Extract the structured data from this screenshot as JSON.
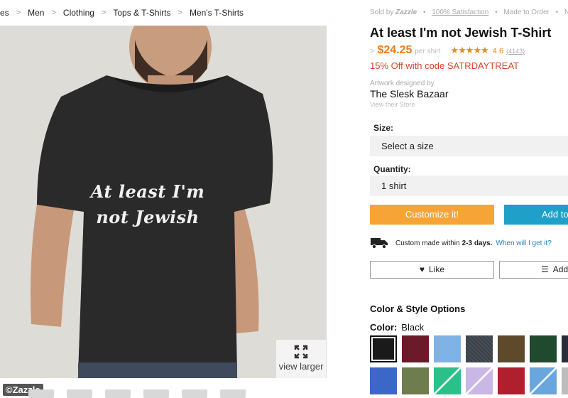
{
  "breadcrumb": {
    "items": [
      "es",
      "Men",
      "Clothing",
      "Tops & T-Shirts",
      "Men's T-Shirts"
    ],
    "separator": ">"
  },
  "image": {
    "shirt_text_line1": "At least I'm",
    "shirt_text_line2": "not Jewish",
    "view_larger": "view larger",
    "watermark": "©Zazzle"
  },
  "seller": {
    "sold_by": "Sold by",
    "brand": "Zazzle",
    "satisfaction": "100% Satisfaction",
    "made_to_order": "Made to Order",
    "trailing": "N"
  },
  "product": {
    "title": "At least I'm not Jewish T-Shirt",
    "price_arrow": ">",
    "price": "$24.25",
    "per_unit": "per shirt",
    "stars": "★★★★★",
    "rating": "4.6",
    "review_count": "(4143)",
    "promo": "15% Off with code SATRDAYTREAT",
    "artwork_label": "Artwork designed by",
    "store_name": "The Slesk Bazaar",
    "store_link": "View their Store"
  },
  "options": {
    "size_label": "Size:",
    "size_value": "Select a size",
    "quantity_label": "Quantity:",
    "quantity_value": "1 shirt"
  },
  "actions": {
    "customize": "Customize it!",
    "add_to_cart": "Add to",
    "like": "Like",
    "add_to_list": "Add"
  },
  "delivery": {
    "prefix": "Custom made within",
    "days": "2-3 days.",
    "when_link": "When will I get it?"
  },
  "colors": {
    "section_title": "Color & Style Options",
    "label": "Color:",
    "selected": "Black",
    "swatches_row1": [
      "#1a1a1a",
      "#6b1a2a",
      "#7fb3e6",
      "#3a4048",
      "#5e4a2a",
      "#1f4a2e",
      "#2a2e3a"
    ],
    "swatches_row2": [
      "#3b67c9",
      "#6e7d4e",
      "#2bbf8a",
      "#c9b8e6",
      "#b01f2e",
      "#6aa6dc",
      "#bdbdbd"
    ]
  }
}
